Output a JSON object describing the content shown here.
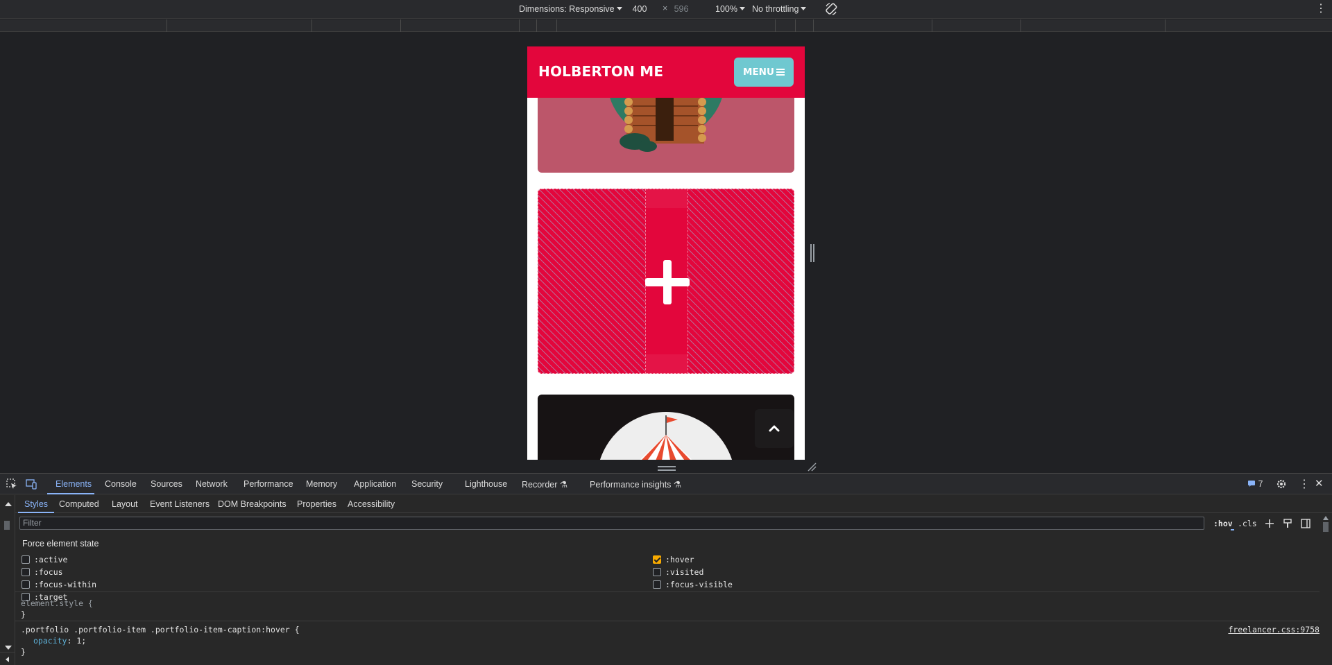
{
  "device_toolbar": {
    "dimensions_label": "Dimensions: Responsive",
    "width": "400",
    "times": "×",
    "height": "596",
    "zoom": "100%",
    "throttling": "No throttling"
  },
  "viewport": {
    "brand": "HOLBERTON ME",
    "menu_label": "MENU",
    "overlay_icon": "plus-icon",
    "scroll_top_icon": "chevron-up-icon"
  },
  "devtools": {
    "tabs": [
      "Elements",
      "Console",
      "Sources",
      "Network",
      "Performance",
      "Memory",
      "Application",
      "Security",
      "Lighthouse",
      "Recorder",
      "Performance insights"
    ],
    "active_tab": "Elements",
    "issues_count": "7",
    "subtabs": [
      "Styles",
      "Computed",
      "Layout",
      "Event Listeners",
      "DOM Breakpoints",
      "Properties",
      "Accessibility"
    ],
    "active_subtab": "Styles",
    "filter_placeholder": "Filter",
    "hov": ":hov",
    "cls": ".cls",
    "force_state_title": "Force element state",
    "states_left": [
      ":active",
      ":focus",
      ":focus-within",
      ":target"
    ],
    "states_right": [
      ":hover",
      ":visited",
      ":focus-visible"
    ],
    "checked_state": ":hover",
    "rules": {
      "element_style_selector": "element.style {",
      "element_style_close": "}",
      "hover_selector": ".portfolio .portfolio-item .portfolio-item-caption:hover {",
      "hover_prop": "opacity",
      "hover_value": ": 1;",
      "hover_close": "}",
      "source": "freelancer.css:9758"
    }
  },
  "colors": {
    "nav_red": "#e3063c",
    "menu_teal": "#6fc8d0",
    "active_blue": "#8ab4f8",
    "checked_orange": "#f9ab00"
  }
}
